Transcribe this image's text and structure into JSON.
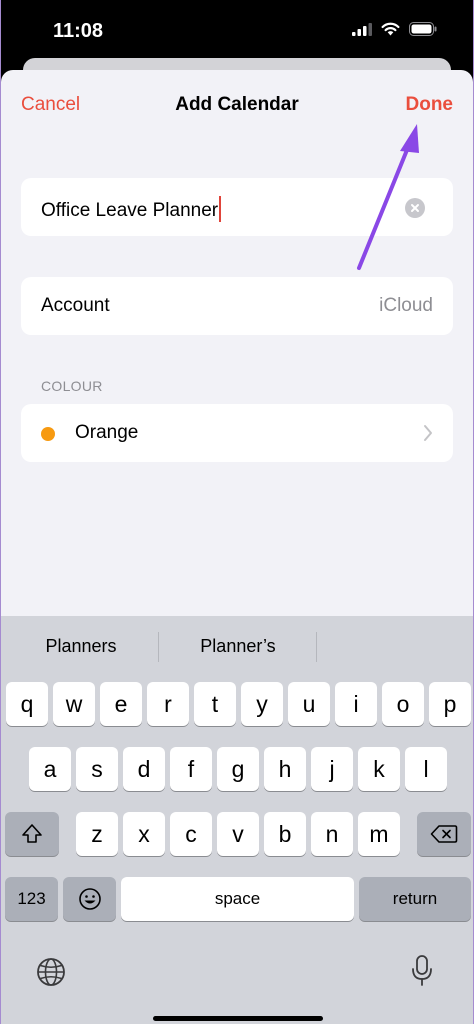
{
  "status": {
    "time": "11:08"
  },
  "nav": {
    "cancel": "Cancel",
    "title": "Add Calendar",
    "done": "Done"
  },
  "name_field": {
    "value": "Office Leave Planner"
  },
  "account": {
    "label": "Account",
    "value": "iCloud"
  },
  "colour_section": {
    "header": "COLOUR",
    "selected": "Orange",
    "dot_color": "#f79a11"
  },
  "accent_color": "#ea4e3d",
  "arrow_color": "#8a48e6",
  "suggestions": [
    "Planners",
    "Planner’s"
  ],
  "keyboard": {
    "row1": [
      "q",
      "w",
      "e",
      "r",
      "t",
      "y",
      "u",
      "i",
      "o",
      "p"
    ],
    "row2": [
      "a",
      "s",
      "d",
      "f",
      "g",
      "h",
      "j",
      "k",
      "l"
    ],
    "row3": [
      "z",
      "x",
      "c",
      "v",
      "b",
      "n",
      "m"
    ],
    "numbers": "123",
    "space": "space",
    "return": "return"
  },
  "icons": [
    "signal-icon",
    "wifi-icon",
    "battery-icon",
    "clear-icon",
    "chevron-right-icon",
    "shift-icon",
    "backspace-icon",
    "emoji-icon",
    "globe-icon",
    "microphone-icon"
  ]
}
